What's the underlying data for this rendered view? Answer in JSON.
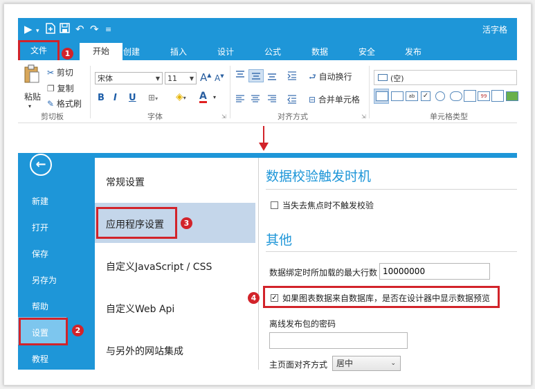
{
  "window": {
    "title": "活字格",
    "quick_access": [
      "play-icon",
      "dropdown-icon",
      "new-icon",
      "save-icon",
      "undo-icon",
      "redo-icon",
      "customize-icon"
    ]
  },
  "tabs": {
    "file": "文件",
    "items": [
      "开始",
      "创建",
      "插入",
      "设计",
      "公式",
      "数据",
      "安全",
      "发布"
    ],
    "active": "开始"
  },
  "ribbon": {
    "clipboard": {
      "paste": "粘贴",
      "cut": "剪切",
      "copy": "复制",
      "format_painter": "格式刷",
      "group": "剪切板"
    },
    "font": {
      "font_name": "宋体",
      "font_size": "11",
      "bold": "B",
      "italic": "I",
      "underline": "U",
      "grow": "A",
      "shrink": "A",
      "color": "A",
      "group": "字体"
    },
    "alignment": {
      "wrap": "自动换行",
      "merge": "合并单元格",
      "group": "对齐方式"
    },
    "cell_type": {
      "current": "(空)",
      "group": "单元格类型"
    }
  },
  "badges": [
    "1",
    "2",
    "3",
    "4"
  ],
  "backstage": {
    "nav": [
      "新建",
      "打开",
      "保存",
      "另存为",
      "帮助",
      "设置",
      "教程"
    ],
    "active_nav": "设置",
    "settings_nav": [
      "常规设置",
      "应用程序设置",
      "自定义JavaScript / CSS",
      "自定义Web Api",
      "与另外的网站集成"
    ],
    "active_setting": "应用程序设置",
    "section1": {
      "title": "数据校验触发时机",
      "option": "当失去焦点时不触发校验",
      "checked": false
    },
    "section2": {
      "title": "其他",
      "max_rows_label": "数据绑定时所加载的最大行数",
      "max_rows_value": "10000000",
      "preview_option": "如果图表数据来自数据库，是否在设计器中显示数据预览",
      "preview_checked": true,
      "offline_password_label": "离线发布包的密码",
      "offline_password_value": "",
      "align_label": "主页面对齐方式",
      "align_value": "居中"
    }
  },
  "colors": {
    "accent": "#1e96d8",
    "highlight": "#d2232a",
    "nav_active": "#7dc6ee",
    "selected_item": "#c4d6ea"
  }
}
